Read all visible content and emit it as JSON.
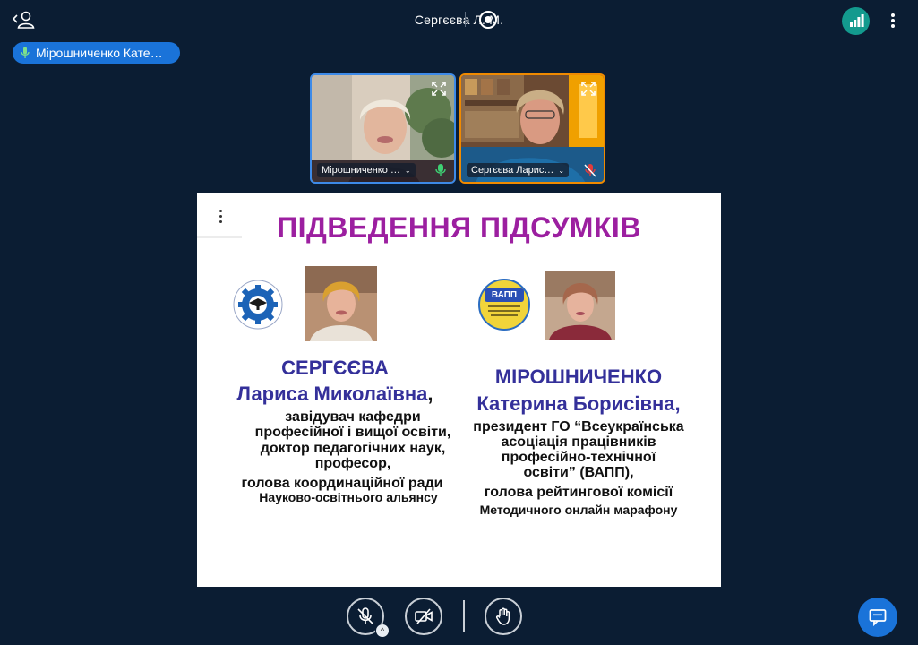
{
  "top_bar": {
    "users_icon": "user-icon",
    "meeting_title": "Сергєєва Л. М.",
    "record_icon": "record-icon",
    "connection_icon": "signal-bars-icon",
    "more_icon": "more-vertical-icon"
  },
  "talking_indicator": {
    "icon": "microphone-icon",
    "name": "Мірошниченко Кате…"
  },
  "video_tiles": [
    {
      "label": "Мірошниченко …",
      "mic_state": "on",
      "accent": "#3d8ae8"
    },
    {
      "label": "Сергєєва Ларис…",
      "mic_state": "muted",
      "accent": "#f08a00"
    }
  ],
  "slide": {
    "title": "ПІДВЕДЕННЯ ПІДСУМКІВ",
    "left": {
      "surname": "СЕРГЄЄВА",
      "name": "Лариса Миколаївна",
      "comma": ",",
      "lines": [
        "завідувач кафедри",
        "професійної і вищої освіти,",
        "доктор педагогічних наук,",
        "професор,",
        "голова координаційної ради",
        "Науково-освітнього альянсу"
      ]
    },
    "right": {
      "logo_text": "ВАПП",
      "surname": "МІРОШНИЧЕНКО",
      "name": "Катерина Борисівна,",
      "lines": [
        "президент ГО “Всеукраїнська",
        "асоціація працівників",
        "професійно-технічної",
        "освіти” (ВАПП),",
        "голова рейтингової комісії",
        "Методичного онлайн марафону"
      ]
    },
    "colors": {
      "title": "#9c1fa0",
      "name": "#34309a"
    }
  },
  "controls": {
    "mic_icon": "microphone-muted-icon",
    "camera_icon": "camera-off-icon",
    "hand_icon": "raise-hand-icon",
    "chat_icon": "chat-icon",
    "caret": "^"
  }
}
